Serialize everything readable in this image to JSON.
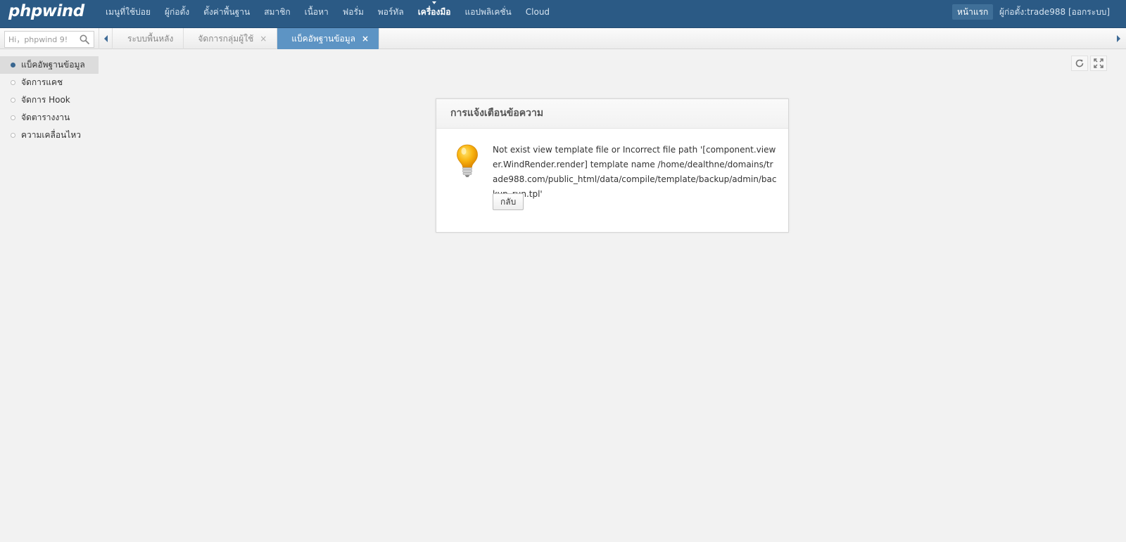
{
  "header": {
    "logo": "phpwind",
    "nav": [
      "เมนูที่ใช้บ่อย",
      "ผู้ก่อตั้ง",
      "ตั้งค่าพื้นฐาน",
      "สมาชิก",
      "เนื้อหา",
      "ฟอรั่ม",
      "พอร์ทัล",
      "เครื่องมือ",
      "แอปพลิเคชั่น",
      "Cloud"
    ],
    "active_nav_index": 7,
    "home_label": "หน้าแรก",
    "admin_prefix": "ผู้ก่อตั้ง:trade988",
    "logout_label": "[ออกระบบ]"
  },
  "search": {
    "placeholder": "Hi，phpwind 9!"
  },
  "tabs": [
    {
      "label": "ระบบพื้นหลัง",
      "closable": false
    },
    {
      "label": "จัดการกลุ่มผู้ใช้",
      "closable": true
    },
    {
      "label": "แบ็คอัพฐานข้อมูล",
      "closable": true,
      "active": true
    }
  ],
  "tab_close_glyph": "×",
  "sidebar": {
    "items": [
      {
        "label": "แบ็คอัพฐานข้อมูล",
        "active": true
      },
      {
        "label": "จัดการแคช"
      },
      {
        "label": "จัดการ Hook"
      },
      {
        "label": "จัดตารางงาน"
      },
      {
        "label": "ความเคลื่อนไหว"
      }
    ]
  },
  "tools": {
    "refresh_icon": "refresh-icon",
    "fullscreen_icon": "fullscreen-icon"
  },
  "dialog": {
    "title": "การแจ้งเตือนข้อความ",
    "icon": "lightbulb-icon",
    "message": "Not exist view template file or Incorrect file path '[component.viewer.WindRender.render] template name /home/dealthne/domains/trade988.com/public_html/data/compile/template/backup/admin/backup_run.tpl'",
    "back_label": "กลับ"
  },
  "colors": {
    "header_bg": "#2b5a85",
    "active_tab_bg": "#5d94c4",
    "page_bg": "#f2f2f2"
  }
}
